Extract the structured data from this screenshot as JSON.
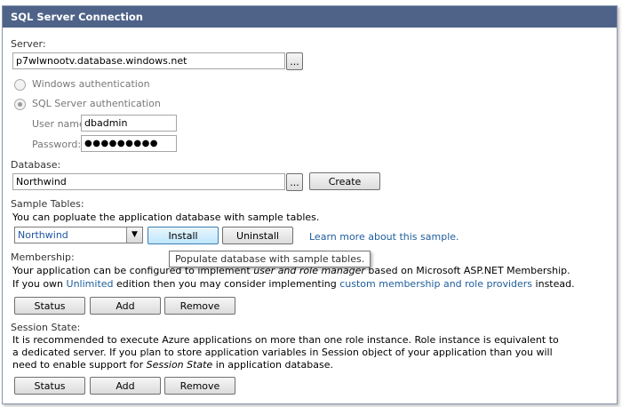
{
  "title": "SQL Server Connection",
  "server": {
    "label": "Server:",
    "value": "p7wlwnootv.database.windows.net",
    "browse_label": "..."
  },
  "auth": {
    "windows_label": "Windows authentication",
    "sql_label": "SQL Server authentication",
    "selected": "sql",
    "username_label": "User name:",
    "username_value": "dbadmin",
    "password_label": "Password:",
    "password_value": "●●●●●●●●●"
  },
  "database": {
    "label": "Database:",
    "value": "Northwind",
    "browse_label": "...",
    "create_label": "Create"
  },
  "sample_tables": {
    "label": "Sample Tables:",
    "description": "You can popluate the application database with sample tables.",
    "selected": "Northwind",
    "install_label": "Install",
    "uninstall_label": "Uninstall",
    "learn_more": "Learn more about this sample.",
    "tooltip": "Populate database with sample tables."
  },
  "membership": {
    "label": "Membership:",
    "line1_a": "Your application can be configured to implement ",
    "line1_em": "user and role manager",
    "line1_b": " based on Microsoft ASP.NET Membership.",
    "line2_a": "If you own ",
    "line2_link1": "Unlimited",
    "line2_b": " edition then you may consider implementing ",
    "line2_link2": "custom membership and role providers",
    "line2_c": " instead.",
    "status_label": "Status",
    "add_label": "Add",
    "remove_label": "Remove"
  },
  "session_state": {
    "label": "Session State:",
    "line1": "It is recommended to execute Azure applications on more than one role instance. Role instance is equivalent to",
    "line2": "a dedicated server. If you plan to store application variables in Session object of your application than you will",
    "line3_a": "need to enable support for ",
    "line3_em": "Session State",
    "line3_b": " in application database.",
    "status_label": "Status",
    "add_label": "Add",
    "remove_label": "Remove"
  },
  "colors": {
    "titlebar": "#4f6389",
    "link": "#1d5d9c"
  }
}
